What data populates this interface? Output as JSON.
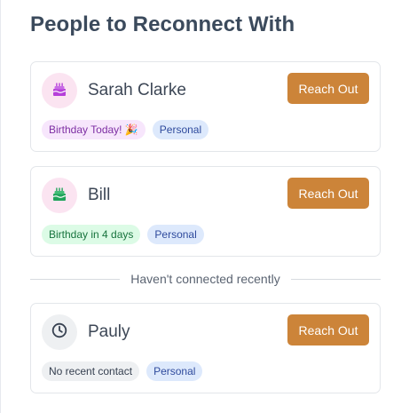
{
  "header": {
    "title": "People to Reconnect With"
  },
  "contacts": [
    {
      "name": "Sarah Clarke",
      "icon": "birthday-cake-icon",
      "action_label": "Reach Out",
      "tags": [
        "Birthday Today! 🎉",
        "Personal"
      ]
    },
    {
      "name": "Bill",
      "icon": "birthday-cake-icon",
      "action_label": "Reach Out",
      "tags": [
        "Birthday in 4 days",
        "Personal"
      ]
    }
  ],
  "divider": {
    "label": "Haven't connected recently"
  },
  "recent": [
    {
      "name": "Pauly",
      "icon": "clock-icon",
      "action_label": "Reach Out",
      "tags": [
        "No recent contact",
        "Personal"
      ]
    }
  ],
  "colors": {
    "accent": "#cc8439",
    "birthday_tag_bg": "#f7e6fc",
    "soon_tag_bg": "#dcfbe6",
    "personal_tag_bg": "#dde9fc",
    "neutral_tag_bg": "#eef0f2"
  }
}
